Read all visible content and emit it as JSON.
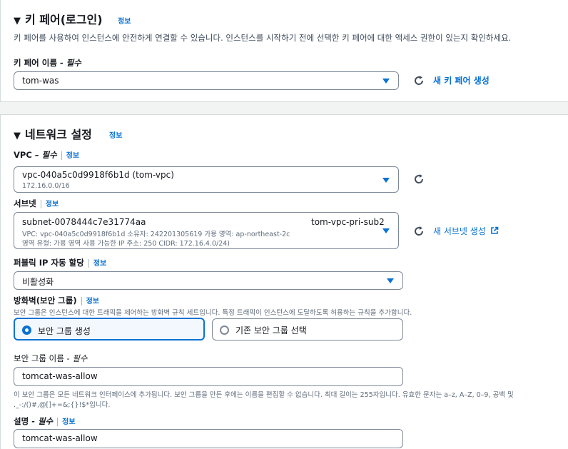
{
  "keypair": {
    "title": "키 페어(로그인)",
    "info": "정보",
    "description": "키 페어를 사용하여 인스턴스에 안전하게 연결할 수 있습니다. 인스턴스를 시작하기 전에 선택한 키 페어에 대한 액세스 권한이 있는지 확인하세요.",
    "name_label": "키 페어 이름 - ",
    "required": "필수",
    "selected": "tom-was",
    "create_link": "새 키 페어 생성"
  },
  "network": {
    "title": "네트워크 설정",
    "info": "정보",
    "vpc": {
      "label": "VPC – ",
      "required": "필수",
      "info": "정보",
      "selected": "vpc-040a5c0d9918f6b1d (tom-vpc)",
      "cidr": "172.16.0.0/16"
    },
    "subnet": {
      "label": "서브넷",
      "info": "정보",
      "selected": "subnet-0078444c7e31774aa",
      "name": "tom-vpc-pri-sub2",
      "line1": "VPC: vpc-040a5c0d9918f6b1d      소유자: 242201305619      가용 영역: ap-northeast-2c",
      "line2": "영역 유형: 가용 영역      사용 가능한 IP 주소: 250      CIDR: 172.16.4.0/24)",
      "create_link": "새 서브넷 생성"
    },
    "public_ip": {
      "label": "퍼블릭 IP 자동 할당",
      "info": "정보",
      "selected": "비활성화"
    },
    "firewall": {
      "label": "방화벽(보안 그룹)",
      "info": "정보",
      "description": "보안 그룹은 인스턴스에 대한 트래픽을 제어하는 방화벽 규칙 세트입니다. 특정 트래픽이 인스턴스에 도달하도록 허용하는 규칙을 추가합니다.",
      "option_create": "보안 그룹 생성",
      "option_existing": "기존 보안 그룹 선택"
    },
    "sg_name": {
      "label": "보안 그룹 이름 - ",
      "required": "필수",
      "value": "tomcat-was-allow",
      "hint1": "이 보안 그룹은 모든 네트워크 인터페이스에 추가됩니다. 보안 그룹을 만든 후에는 이름을 편집할 수 없습니다. 최대 길이는 255자입니다. 유효한 문자는 a–z, A–Z, 0–9, 공백 및",
      "hint2": "._-:/()#,@[]+=&;{}!$*입니다."
    },
    "description_field": {
      "label": "설명 - ",
      "required": "필수",
      "info": "정보",
      "value": "tomcat-was-allow"
    }
  },
  "colors": {
    "accent": "#0972d3",
    "border": "#7d8998",
    "text": "#16191f"
  }
}
